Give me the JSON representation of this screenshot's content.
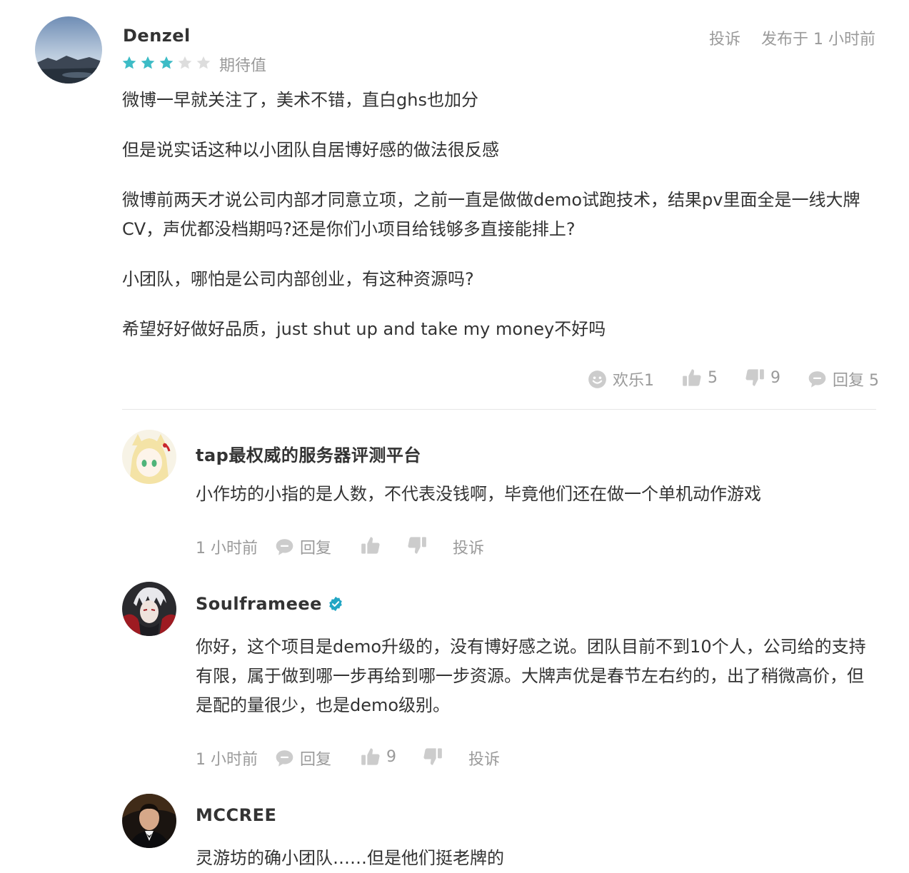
{
  "review": {
    "author": "Denzel",
    "rating": 3,
    "rating_max": 5,
    "rating_label": "期待值",
    "report_label": "投诉",
    "time": "发布于 1 小时前",
    "paragraphs": [
      "微博一早就关注了，美术不错，直白ghs也加分",
      "但是说实话这种以小团队自居博好感的做法很反感",
      "微博前两天才说公司内部才同意立项，之前一直是做做demo试跑技术，结果pv里面全是一线大牌CV，声优都没档期吗?还是你们小项目给钱够多直接能排上?",
      "小团队，哪怕是公司内部创业，有这种资源吗?",
      "希望好好做好品质，just shut up and take my money不好吗"
    ],
    "actions": {
      "fun_label": "欢乐1",
      "like_count": "5",
      "dislike_count": "9",
      "reply_label": "回复 5"
    },
    "colors": {
      "star_filled": "#3dbcc6",
      "star_empty": "#dddddd"
    }
  },
  "replies": [
    {
      "author": "tap最权威的服务器评测平台",
      "verified": false,
      "text": "小作坊的小指的是人数，不代表没钱啊，毕竟他们还在做一个单机动作游戏",
      "time": "1 小时前",
      "reply_label": "回复",
      "like_count": "",
      "report_label": "投诉"
    },
    {
      "author": "Soulframeee",
      "verified": true,
      "text": "你好，这个项目是demo升级的，没有博好感之说。团队目前不到10个人，公司给的支持有限，属于做到哪一步再给到哪一步资源。大牌声优是春节左右约的，出了稍微高价，但是配的量很少，也是demo级别。",
      "time": "1 小时前",
      "reply_label": "回复",
      "like_count": "9",
      "report_label": "投诉"
    },
    {
      "author": "MCCREE",
      "verified": false,
      "text": "灵游坊的确小团队……但是他们挺老牌的"
    }
  ],
  "icons": {
    "star": "star-icon",
    "smile": "smile-icon",
    "like": "thumbs-up-icon",
    "dislike": "thumbs-down-icon",
    "reply": "speech-bubble-icon",
    "verified": "verified-badge-icon"
  },
  "colors": {
    "muted": "#9a9a9a",
    "text": "#333333",
    "verified": "#22a6c4",
    "divider": "#e6e6e6"
  }
}
